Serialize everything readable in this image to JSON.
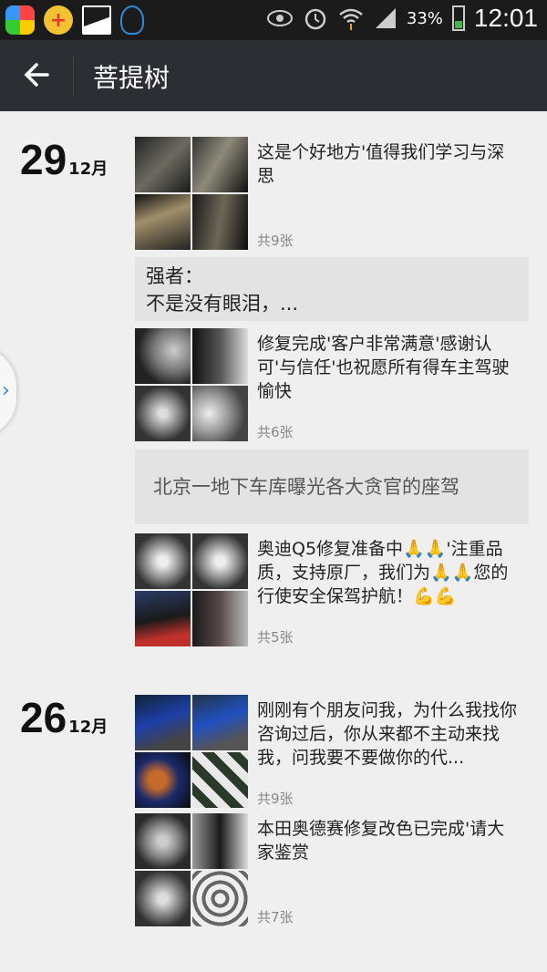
{
  "status_bar": {
    "battery_percent": "33%",
    "time": "12:01"
  },
  "header": {
    "title": "菩提树"
  },
  "groups": [
    {
      "day": "29",
      "month": "12月",
      "entries": [
        {
          "text": "这是个好地方'值得我们学习与深思",
          "count": "共9张"
        },
        {
          "text_line1": "强者：",
          "text_line2": "不是没有眼泪，..."
        },
        {
          "text": "修复完成'客户非常满意'感谢认可'与信任'也祝愿所有得车主驾驶愉快",
          "count": "共6张"
        },
        {
          "text": "北京一地下车库曝光各大贪官的座驾"
        },
        {
          "text": "奥迪Q5修复准备中🙏🙏'注重品质，支持原厂，我们为🙏🙏您的行使安全保驾护航！💪💪",
          "count": "共5张"
        }
      ]
    },
    {
      "day": "26",
      "month": "12月",
      "entries": [
        {
          "text": "刚刚有个朋友问我，为什么我找你咨询过后，你从来都不主动来找我，问我要不要做你的代...",
          "count": "共9张"
        },
        {
          "text": "本田奥德赛修复改色已完成'请大家鉴赏",
          "count": "共7张"
        }
      ]
    }
  ],
  "colors": {
    "titlebar": "#2b2f33",
    "statusbar": "#1b1b1b",
    "background": "#efeff0",
    "textblock": "#e3e3e4",
    "accent": "#2e8bd6"
  },
  "icons": [
    "app-store-icon",
    "health-app-icon",
    "gallery-icon",
    "qq-icon",
    "eye-icon",
    "alarm-icon",
    "wifi-icon",
    "signal-icon",
    "battery-icon",
    "back-arrow-icon",
    "chevron-right-icon"
  ]
}
